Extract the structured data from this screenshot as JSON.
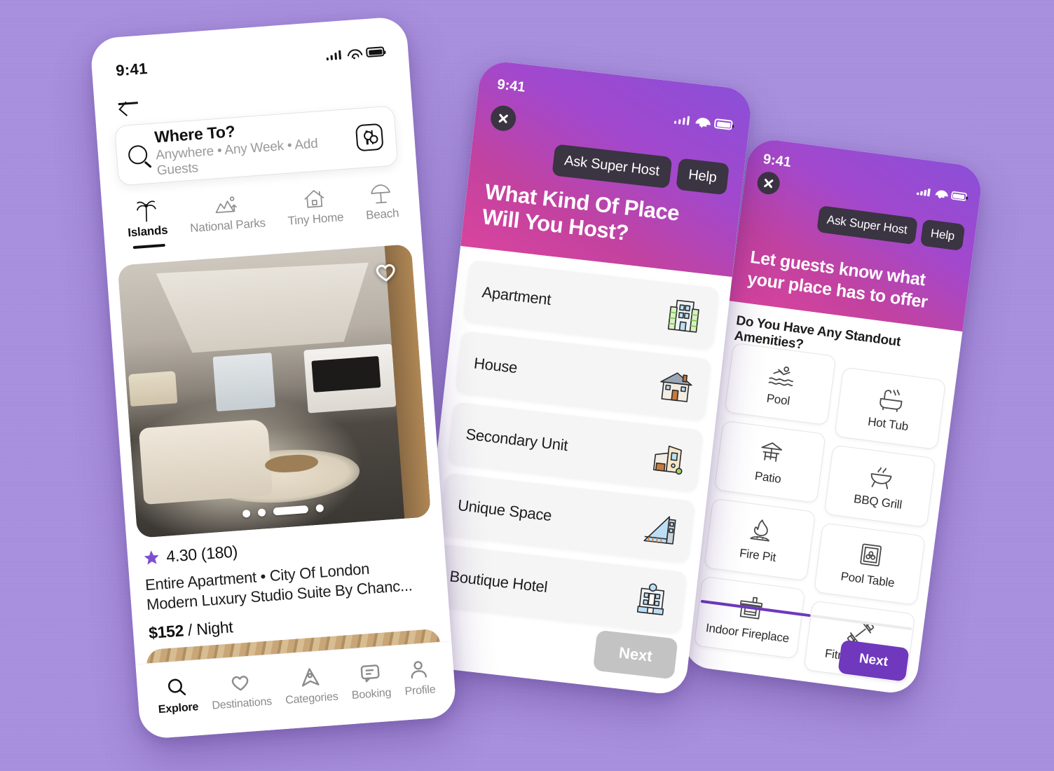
{
  "background_color": "#a98fe0",
  "accent_purple": "#6f38bd",
  "phone1": {
    "name": "explore-screen",
    "status": {
      "time": "9:41"
    },
    "back_icon": "arrow-left-icon",
    "search": {
      "title": "Where To?",
      "subtitle": "Anywhere • Any Week • Add Guests",
      "search_icon": "search-icon",
      "filter_icon": "filter-sliders-icon"
    },
    "categories": [
      {
        "label": "Islands",
        "icon": "palm-tree-icon",
        "active": true
      },
      {
        "label": "National Parks",
        "icon": "mountains-icon",
        "active": false
      },
      {
        "label": "Tiny Home",
        "icon": "house-icon",
        "active": false
      },
      {
        "label": "Beach",
        "icon": "beach-umbrella-icon",
        "active": false
      }
    ],
    "listing": {
      "image_alt": "modern luxury living room interior",
      "favorite_icon": "heart-icon",
      "carousel_dots": 4,
      "carousel_active_index": 2,
      "rating": "4.30 (180)",
      "star_icon": "star-icon",
      "line1": "Entire Apartment • City Of London",
      "line2": "Modern Luxury Studio Suite By Chanc...",
      "price_amount": "$152",
      "price_unit": "/ Night"
    },
    "listing2": {
      "image_alt": "wooden deck",
      "favorite_icon": "heart-icon"
    },
    "tabs": [
      {
        "label": "Explore",
        "icon": "search-icon",
        "active": true
      },
      {
        "label": "Destinations",
        "icon": "heart-icon",
        "active": false
      },
      {
        "label": "Categories",
        "icon": "airbnb-logo-icon",
        "active": false
      },
      {
        "label": "Booking",
        "icon": "chat-bubble-icon",
        "active": false
      },
      {
        "label": "Profile",
        "icon": "user-icon",
        "active": false
      }
    ]
  },
  "phone2": {
    "name": "place-type-screen",
    "status": {
      "time": "9:41"
    },
    "close_icon": "close-icon",
    "header_buttons": [
      {
        "label": "Ask Super Host"
      },
      {
        "label": "Help"
      }
    ],
    "title": "What Kind Of Place Will You Host?",
    "options": [
      {
        "label": "Apartment",
        "icon": "apartment-building-icon"
      },
      {
        "label": "House",
        "icon": "house-icon"
      },
      {
        "label": "Secondary Unit",
        "icon": "secondary-unit-icon"
      },
      {
        "label": "Unique Space",
        "icon": "unique-space-icon"
      },
      {
        "label": "Boutique Hotel",
        "icon": "hotel-icon"
      }
    ],
    "next_label": "Next",
    "next_enabled": false
  },
  "phone3": {
    "name": "amenities-screen",
    "status": {
      "time": "9:41"
    },
    "close_icon": "close-icon",
    "header_buttons": [
      {
        "label": "Ask Super Host"
      },
      {
        "label": "Help"
      }
    ],
    "title": "Let guests know what your place has to offer",
    "subtitle": "Do You Have Any Standout Amenities?",
    "amenities": [
      {
        "label": "Pool",
        "icon": "swimmer-icon"
      },
      {
        "label": "Hot Tub",
        "icon": "bathtub-icon"
      },
      {
        "label": "Patio",
        "icon": "patio-table-icon"
      },
      {
        "label": "BBQ Grill",
        "icon": "grill-icon"
      },
      {
        "label": "Fire Pit",
        "icon": "fire-icon"
      },
      {
        "label": "Pool Table",
        "icon": "pool-table-icon"
      },
      {
        "label": "Indoor Fireplace",
        "icon": "fireplace-icon"
      },
      {
        "label": "Fitness Gym",
        "icon": "dumbbell-icon"
      }
    ],
    "progress_percent": 52,
    "next_label": "Next",
    "next_enabled": true
  }
}
